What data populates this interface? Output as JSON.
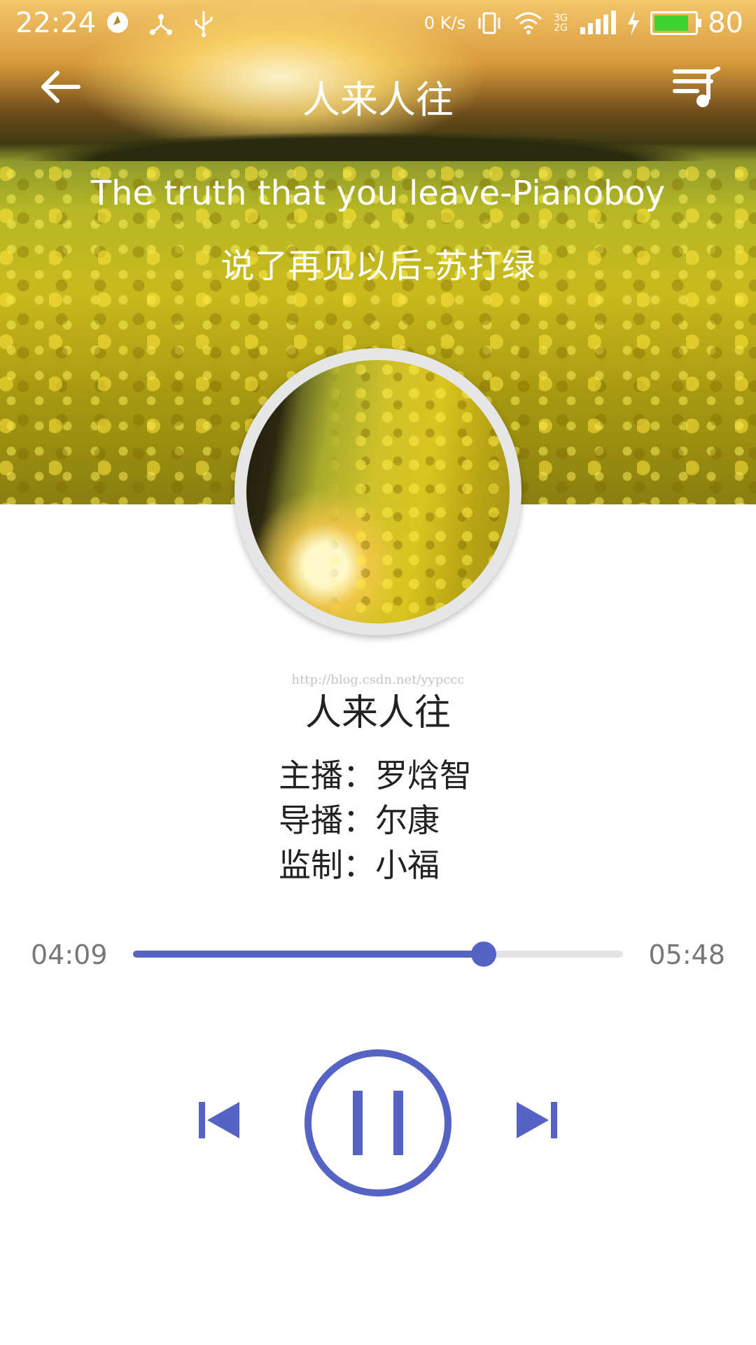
{
  "status_bar": {
    "time": "22:24",
    "network_speed": "0 K/s",
    "network_type": "3G 2G",
    "battery_level": "80",
    "icons": [
      "app-notification-icon",
      "share-icon",
      "usb-icon",
      "vibrate-icon",
      "wifi-icon",
      "signal-icon",
      "charging-icon",
      "battery-icon"
    ]
  },
  "toolbar": {
    "title": "人来人往",
    "back_icon": "back-arrow-icon",
    "playlist_icon": "playlist-icon"
  },
  "now_playing": {
    "english_title": "The truth that you leave-Pianoboy",
    "chinese_title": "说了再见以后-苏打绿"
  },
  "watermark": "http://blog.csdn.net/yypccc",
  "program": {
    "name": "人来人往",
    "credits": [
      {
        "role": "主播：",
        "person": "罗焓智"
      },
      {
        "role": "导播：",
        "person": "尔康"
      },
      {
        "role": "监制：",
        "person": "小福"
      }
    ]
  },
  "progress": {
    "current": "04:09",
    "total": "05:48",
    "fraction": 0.716
  },
  "controls": {
    "prev_icon": "skip-previous-icon",
    "pause_icon": "pause-icon",
    "next_icon": "skip-next-icon"
  },
  "colors": {
    "accent": "#5563c4",
    "track": "#e3e3e3",
    "battery": "#3fd12d"
  }
}
